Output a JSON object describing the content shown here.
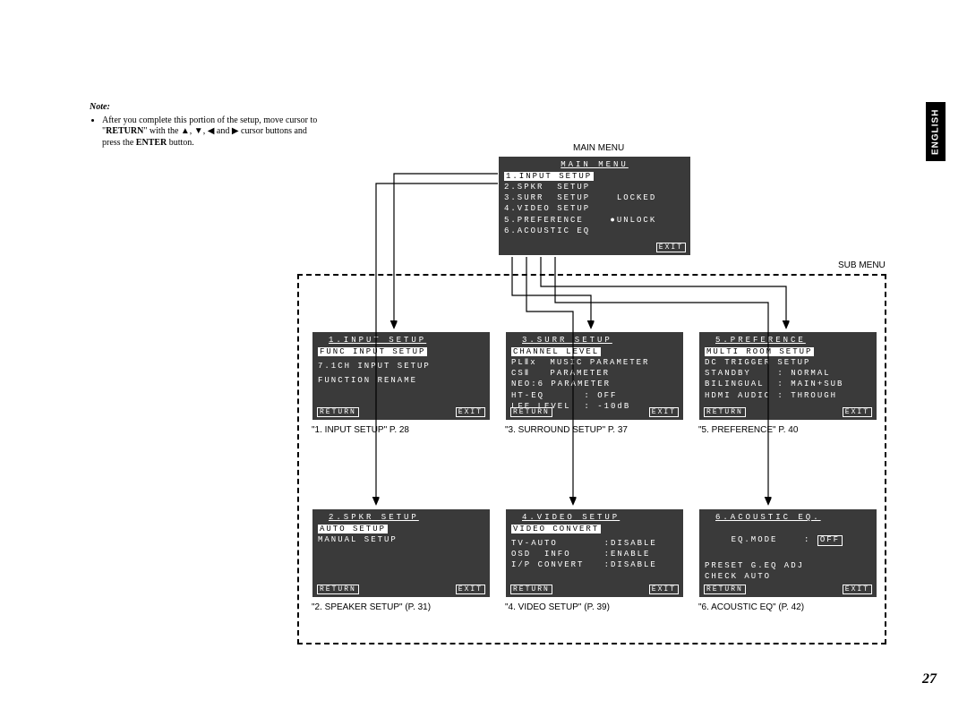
{
  "page_number": "27",
  "language_tab": "ENGLISH",
  "note": {
    "heading": "Note:",
    "body_prefix": "After you complete this portion of the setup, move cursor to \"",
    "return_word": "RETURN",
    "body_mid": "\" with the ",
    "body_tail": " cursor buttons and press the ",
    "enter_word": "ENTER",
    "body_end": " button."
  },
  "labels": {
    "main_menu": "MAIN MENU",
    "sub_menu": "SUB MENU"
  },
  "buttons": {
    "return": "RETURN",
    "exit": "EXIT"
  },
  "main": {
    "title": "MAIN MENU",
    "items": [
      "1.INPUT SETUP",
      "2.SPKR  SETUP",
      "3.SURR  SETUP    LOCKED",
      "4.VIDEO SETUP",
      "5.PREFERENCE    ●UNLOCK",
      "6.ACOUSTIC EQ"
    ]
  },
  "panels": {
    "p1": {
      "title": "1.INPUT SETUP",
      "highlight": "FUNC INPUT SETUP",
      "lines": [
        "7.1CH INPUT SETUP",
        "FUNCTION RENAME"
      ],
      "caption": "\"1. INPUT SETUP\" P. 28"
    },
    "p2": {
      "title": "2.SPKR SETUP",
      "highlight": "AUTO SETUP",
      "lines": [
        "MANUAL SETUP"
      ],
      "caption": "\"2. SPEAKER SETUP\" (P. 31)"
    },
    "p3": {
      "title": "3.SURR SETUP",
      "highlight": "CHANNEL LEVEL",
      "lines": [
        "PLⅡx  MUSIC PARAMETER",
        "CSⅡ   PARAMETER",
        "NEO:6 PARAMETER",
        "",
        "HT-EQ      : OFF",
        "LFE LEVEL  : -10dB"
      ],
      "caption": "\"3. SURROUND SETUP\" P. 37"
    },
    "p4": {
      "title": "4.VIDEO SETUP",
      "highlight": "VIDEO CONVERT",
      "lines": [
        "TV-AUTO       :DISABLE",
        "OSD  INFO     :ENABLE",
        "I/P CONVERT   :DISABLE"
      ],
      "caption": "\"4. VIDEO SETUP\" (P. 39)"
    },
    "p5": {
      "title": "5.PREFERENCE",
      "highlight": "MULTI ROOM SETUP",
      "lines": [
        "DC TRIGGER SETUP",
        "",
        "STANDBY    : NORMAL",
        "BILINGUAL  : MAIN+SUB",
        "HDMI AUDIO : THROUGH"
      ],
      "caption": "\"5. PREFERENCE\" P. 40"
    },
    "p6": {
      "title": "6.ACOUSTIC EQ.",
      "line1_key": "EQ.MODE",
      "line1_sep": ":",
      "line1_val": "OFF",
      "lines": [
        "PRESET G.EQ ADJ",
        "CHECK AUTO"
      ],
      "caption": "\"6. ACOUSTIC EQ\" (P. 42)"
    }
  }
}
